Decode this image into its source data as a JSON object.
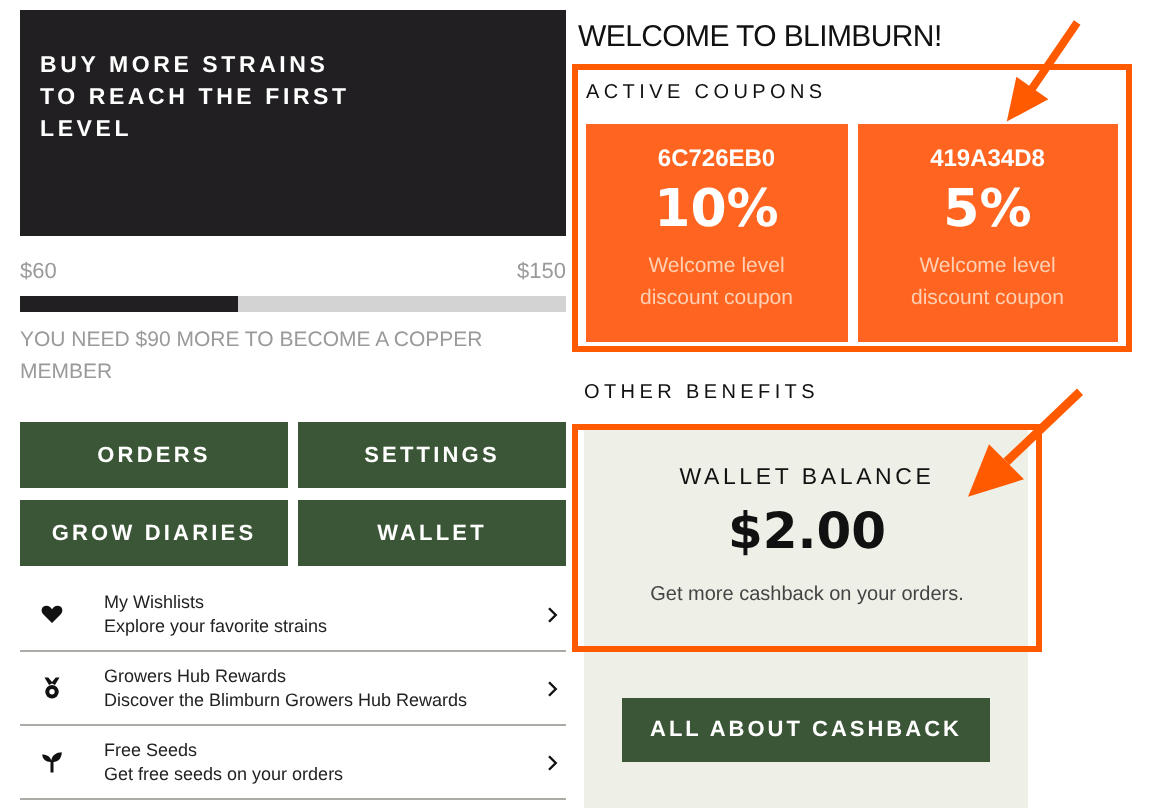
{
  "banner": {
    "text": "BUY MORE STRAINS TO REACH THE FIRST LEVEL"
  },
  "progress": {
    "min_label": "$60",
    "max_label": "$150",
    "level": 0.4,
    "message": "YOU NEED $90 MORE TO BECOME A COPPER MEMBER"
  },
  "buttons": [
    "ORDERS",
    "SETTINGS",
    "GROW DIARIES",
    "WALLET"
  ],
  "links": [
    {
      "kind": "heart",
      "title": "My Wishlists",
      "subtitle": "Explore your favorite strains"
    },
    {
      "kind": "medal",
      "title": "Growers Hub Rewards",
      "subtitle": "Discover the Blimburn Growers Hub Rewards"
    },
    {
      "kind": "sprout",
      "title": "Free Seeds",
      "subtitle": "Get free seeds on your orders"
    }
  ],
  "welcome": "WELCOME TO BLIMBURN!",
  "coupons_heading": "ACTIVE COUPONS",
  "coupons": [
    {
      "code": "6C726EB0",
      "discount": "10%",
      "description": "Welcome level discount coupon"
    },
    {
      "code": "419A34D8",
      "discount": "5%",
      "description": "Welcome level discount coupon"
    }
  ],
  "benefits_heading": "OTHER BENEFITS",
  "wallet": {
    "title": "WALLET BALANCE",
    "amount": "$2.00",
    "note": "Get more cashback on your orders.",
    "button": "ALL ABOUT CASHBACK"
  }
}
